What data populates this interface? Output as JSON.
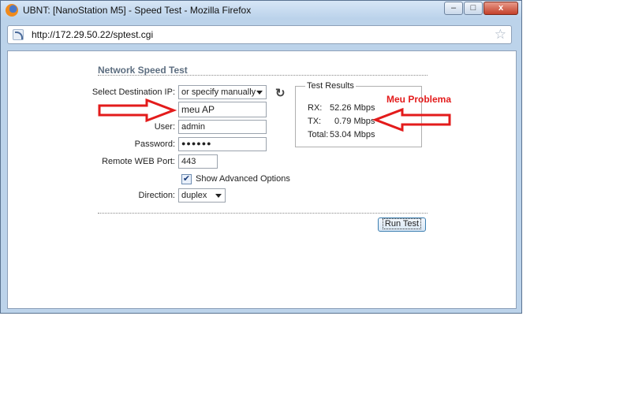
{
  "window": {
    "title": "UBNT: [NanoStation M5] - Speed Test - Mozilla Firefox",
    "controls": {
      "minimize": "–",
      "maximize": "□",
      "close": "x"
    },
    "url": "http://172.29.50.22/sptest.cgi",
    "icons": {
      "app": "firefox-icon",
      "feed": "rss-icon",
      "bookmark": "star-icon"
    }
  },
  "form": {
    "title": "Network Speed Test",
    "destination": {
      "label": "Select Destination IP:",
      "selected": "or specify manually",
      "manual_value": "meu AP"
    },
    "user": {
      "label": "User:",
      "value": "admin"
    },
    "password": {
      "label": "Password:",
      "value": "●●●●●●"
    },
    "port": {
      "label": "Remote WEB Port:",
      "value": "443"
    },
    "advanced": {
      "label": "Show Advanced Options",
      "checked": true,
      "mark": "✔"
    },
    "direction": {
      "label": "Direction:",
      "selected": "duplex"
    },
    "run_label": "Run Test"
  },
  "results": {
    "legend": "Test Results",
    "rx": {
      "label": "RX:",
      "value": "52.26 Mbps"
    },
    "tx": {
      "label": "TX:",
      "value": "0.79 Mbps"
    },
    "total": {
      "label": "Total:",
      "value": "53.04 Mbps"
    }
  },
  "annotation": {
    "text": "Meu Problema",
    "color": "#e31b1b"
  }
}
